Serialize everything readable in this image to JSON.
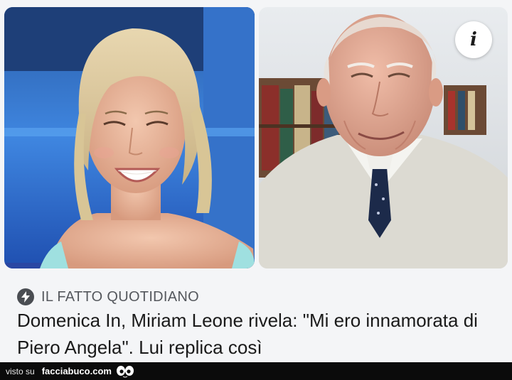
{
  "source": {
    "name": "IL FATTO QUOTIDIANO",
    "icon": "bolt-icon"
  },
  "headline": {
    "text": "Domenica In, Miriam Leone rivela: \"Mi ero innamorata di Piero Angela\". Lui replica così"
  },
  "info_button": {
    "label": "i"
  },
  "footer": {
    "prefix": "visto su",
    "site": "facciabuco.com",
    "logo": "eyes-logo-icon"
  },
  "colors": {
    "footer_bg": "#0b0b0b",
    "card_bg": "#f4f5f7",
    "headline": "#1a1a1a",
    "source": "#55585d"
  }
}
